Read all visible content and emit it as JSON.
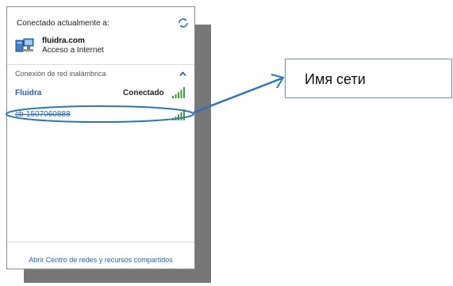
{
  "connected": {
    "title": "Conectado actualmente a:",
    "network_name": "fluidra.com",
    "network_status": "Acceso a Internet"
  },
  "wireless": {
    "header": "Conexión de red inalámbrica",
    "networks": [
      {
        "name": "Fluidra",
        "status": "Conectado"
      },
      {
        "name": "cb-1507060888"
      }
    ]
  },
  "footer": {
    "link": "Abrir Centro de redes y recursos compartidos"
  },
  "callout": {
    "text": "Имя сети"
  },
  "colors": {
    "link_blue": "#1f62b8",
    "annotation_blue": "#2e75b6",
    "signal_green": "#3aa335"
  },
  "icons": {
    "refresh": "refresh-icon",
    "network": "network-computer-icon",
    "collapse": "chevron-up-icon",
    "signal": "signal-strength-icon"
  }
}
